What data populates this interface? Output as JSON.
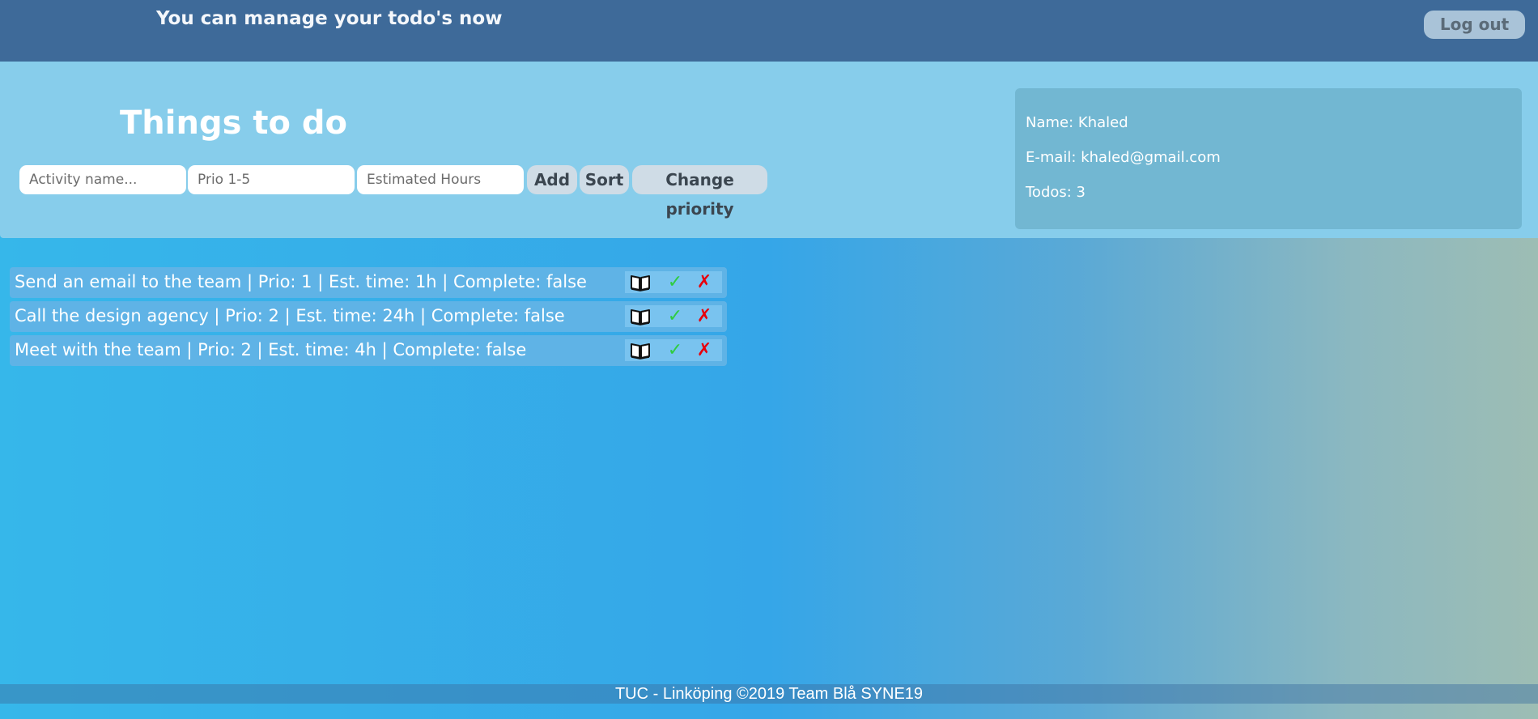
{
  "header": {
    "welcome": "You can manage your todo's now",
    "logout_label": "Log out"
  },
  "main": {
    "title": "Things to do",
    "inputs": {
      "activity_placeholder": "Activity name...",
      "prio_placeholder": "Prio 1-5",
      "hours_placeholder": "Estimated Hours"
    },
    "buttons": {
      "add": "Add",
      "sort": "Sort",
      "change_priority": "Change priority"
    }
  },
  "profile": {
    "name": "Name: Khaled",
    "email": "E-mail: khaled@gmail.com",
    "todos": "Todos: 3"
  },
  "todos": [
    {
      "text": "Send an email to the team | Prio: 1 | Est. time: 1h | Complete: false"
    },
    {
      "text": "Call the design agency | Prio: 2 | Est. time: 24h | Complete: false"
    },
    {
      "text": "Meet with the team | Prio: 2 | Est. time: 4h | Complete: false"
    }
  ],
  "icons": {
    "details": "book-icon",
    "complete": "checkmark-icon",
    "delete": "cross-icon"
  },
  "colors": {
    "complete": "#2ecc40",
    "delete": "#e8000b",
    "topbar": "#3e6a99"
  },
  "footer": {
    "text": "TUC - Linköping ©2019 Team Blå SYNE19"
  }
}
